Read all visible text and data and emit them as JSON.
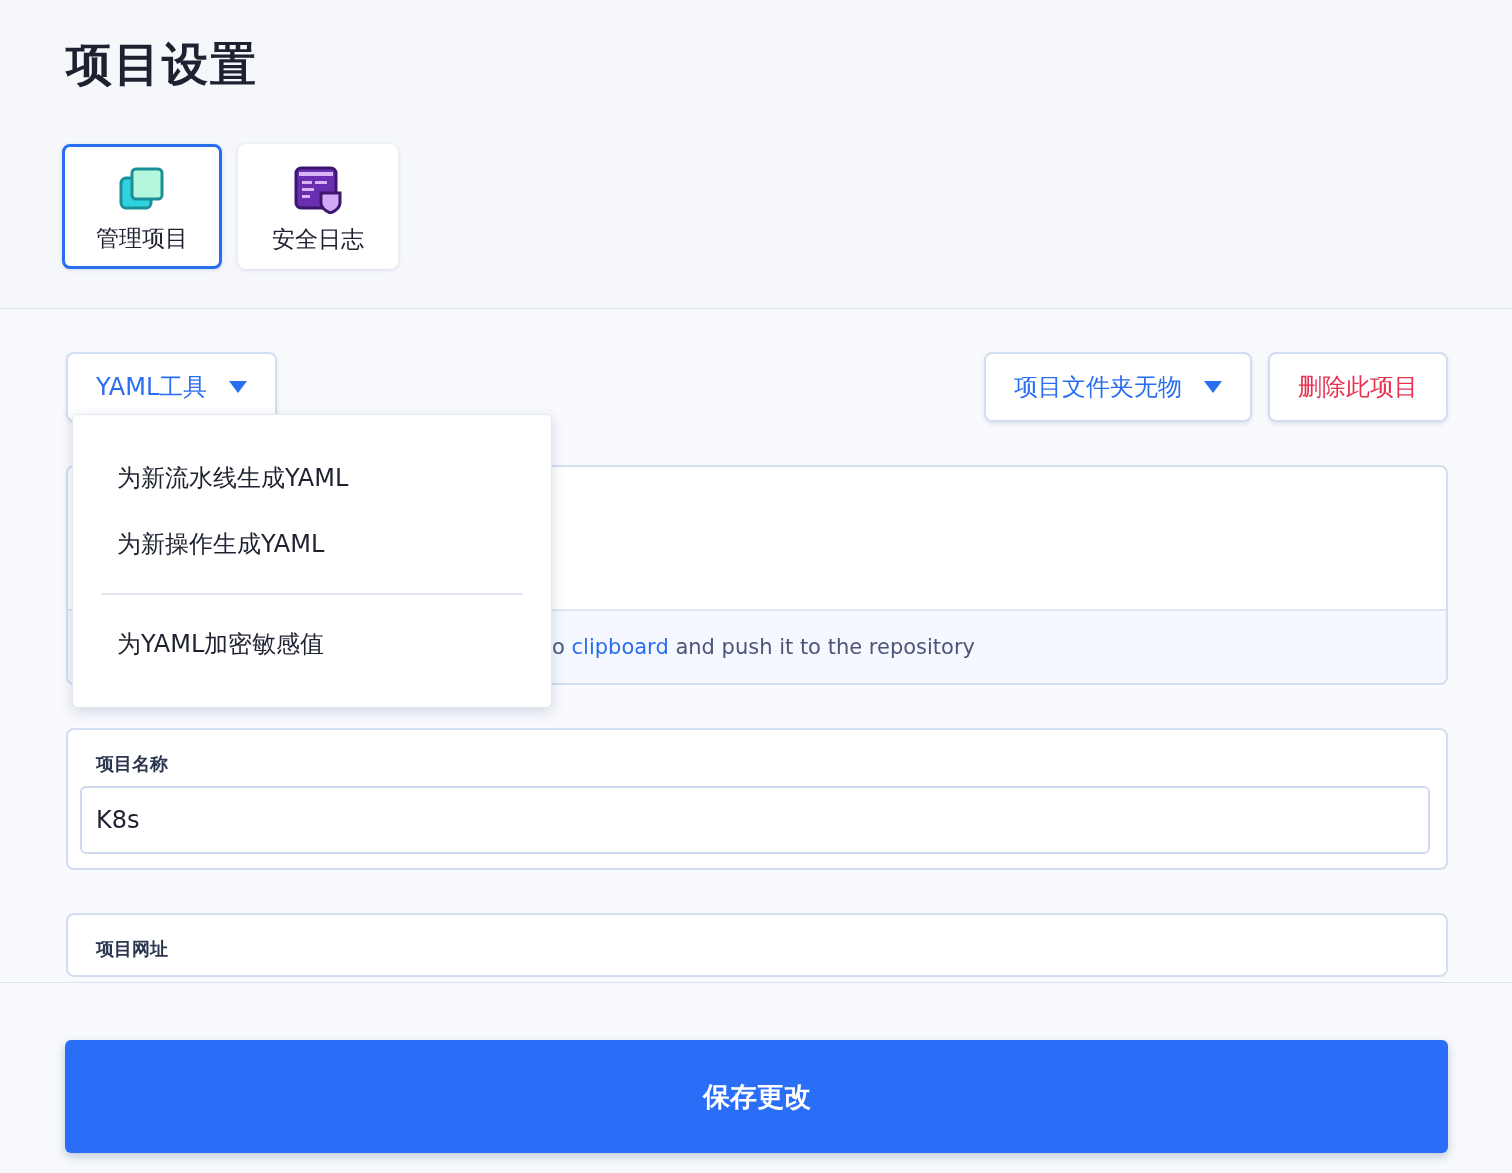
{
  "page": {
    "title": "项目设置"
  },
  "tabs": [
    {
      "label": "管理项目",
      "kind": "squares",
      "selected": true
    },
    {
      "label": "安全日志",
      "kind": "log",
      "selected": false
    }
  ],
  "toolbar": {
    "yaml_tools": {
      "label": "YAML工具",
      "expanded": true,
      "menu": [
        {
          "label": "为新流水线生成YAML",
          "divider_before": false
        },
        {
          "label": "为新操作生成YAML",
          "divider_before": false
        },
        {
          "label": "为YAML加密敏感值",
          "divider_before": true
        }
      ]
    },
    "folder_dropdown": {
      "label": "项目文件夹无物"
    },
    "delete_button": {
      "label": "删除此项目"
    }
  },
  "yaml_card": {
    "footer": {
      "before": "o ",
      "link": "clipboard",
      "after": " and push it to the repository"
    }
  },
  "fields": [
    {
      "label": "项目名称",
      "value": "K8s"
    },
    {
      "label": "项目网址"
    }
  ],
  "save_button": {
    "label": "保存更改"
  }
}
